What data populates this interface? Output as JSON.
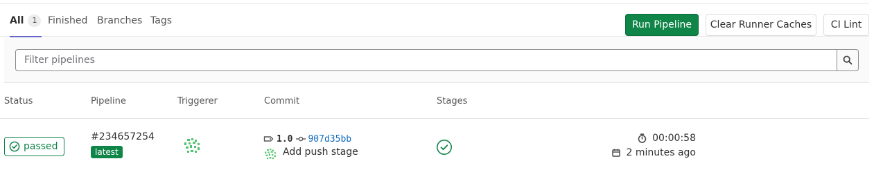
{
  "tabs": [
    {
      "label": "All",
      "count": "1",
      "active": true
    },
    {
      "label": "Finished"
    },
    {
      "label": "Branches"
    },
    {
      "label": "Tags"
    }
  ],
  "actions": {
    "run_pipeline": "Run Pipeline",
    "clear_runner_caches": "Clear Runner Caches",
    "ci_lint": "CI Lint"
  },
  "filter": {
    "placeholder": "Filter pipelines",
    "value": ""
  },
  "table": {
    "headers": [
      "Status",
      "Pipeline",
      "Triggerer",
      "Commit",
      "Stages"
    ],
    "rows": [
      {
        "status": "passed",
        "pipeline_id": "#234657254",
        "badge": "latest",
        "ref": "1.0",
        "sha": "907d35bb",
        "commit_title": "Add push stage",
        "duration": "00:00:58",
        "finished": "2 minutes ago"
      }
    ]
  },
  "colors": {
    "success": "#108548",
    "link": "#1068bf",
    "active_tab_underline": "#6666c4",
    "avatar": "#4fc36d"
  },
  "icons": [
    "check-circle-icon",
    "search-icon",
    "tag-icon",
    "commit-icon",
    "stage-passed-icon",
    "timer-icon",
    "calendar-icon",
    "identicon-avatar"
  ]
}
